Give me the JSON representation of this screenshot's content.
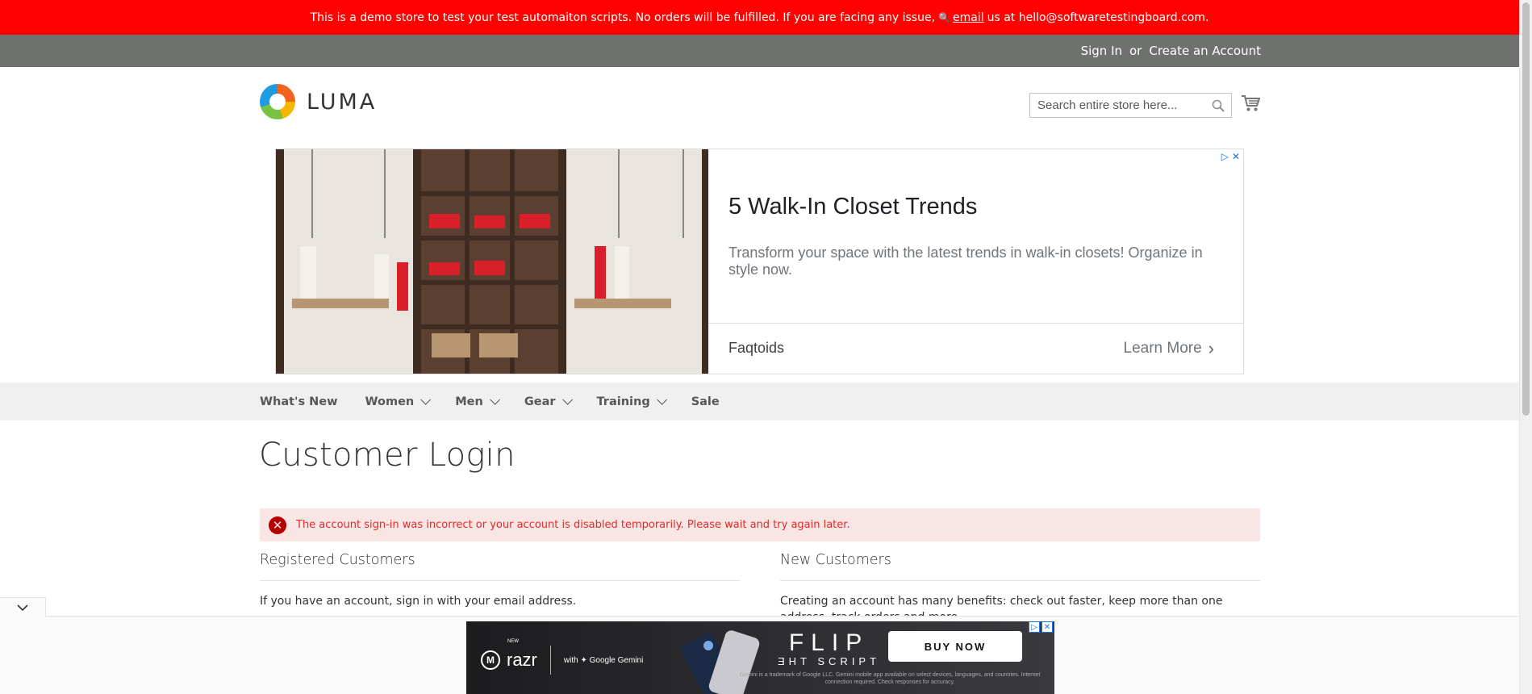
{
  "demo_notice": {
    "text": "This is a demo store to test your test automaiton scripts. No orders will be fulfilled. If you are facing any issue,",
    "link_text": "email",
    "suffix": "us at hello@softwaretestingboard.com."
  },
  "header": {
    "sign_in": "Sign In",
    "or": "or",
    "create_account": "Create an Account",
    "logo_text": "LUMA",
    "search_placeholder": "Search entire store here...",
    "search_icon": "search-icon",
    "cart_icon": "cart-icon"
  },
  "ad": {
    "title": "5 Walk-In Closet Trends",
    "description": "Transform your space with the latest trends in walk-in closets! Organize in style now.",
    "advertiser": "Faqtoids",
    "cta": "Learn More"
  },
  "nav": {
    "items": [
      {
        "label": "What's New",
        "has_caret": false
      },
      {
        "label": "Women",
        "has_caret": true
      },
      {
        "label": "Men",
        "has_caret": true
      },
      {
        "label": "Gear",
        "has_caret": true
      },
      {
        "label": "Training",
        "has_caret": true
      },
      {
        "label": "Sale",
        "has_caret": false
      }
    ]
  },
  "page": {
    "title": "Customer Login",
    "error": "The account sign-in was incorrect or your account is disabled temporarily. Please wait and try again later.",
    "registered": {
      "title": "Registered Customers",
      "text": "If you have an account, sign in with your email address."
    },
    "new_customers": {
      "title": "New Customers",
      "text": "Creating an account has many benefits: check out faster, keep more than one address, track orders and more."
    }
  },
  "sticky_ad": {
    "new_label": "NEW",
    "brand": "razr",
    "gemini": "with ✦ Google Gemini",
    "headline": "FLIP",
    "subline": "ƎHT SCRIPT",
    "button": "BUY NOW",
    "fine_print": "Gemini is a trademark of Google LLC. Gemini mobile app available on select devices, languages, and countries. Internet connection required. Check responses for accuracy."
  },
  "colors": {
    "demo_bar": "#ff0101",
    "panel": "#6e716e",
    "error_bg": "#fae5e5",
    "error_text": "#e02b27"
  }
}
